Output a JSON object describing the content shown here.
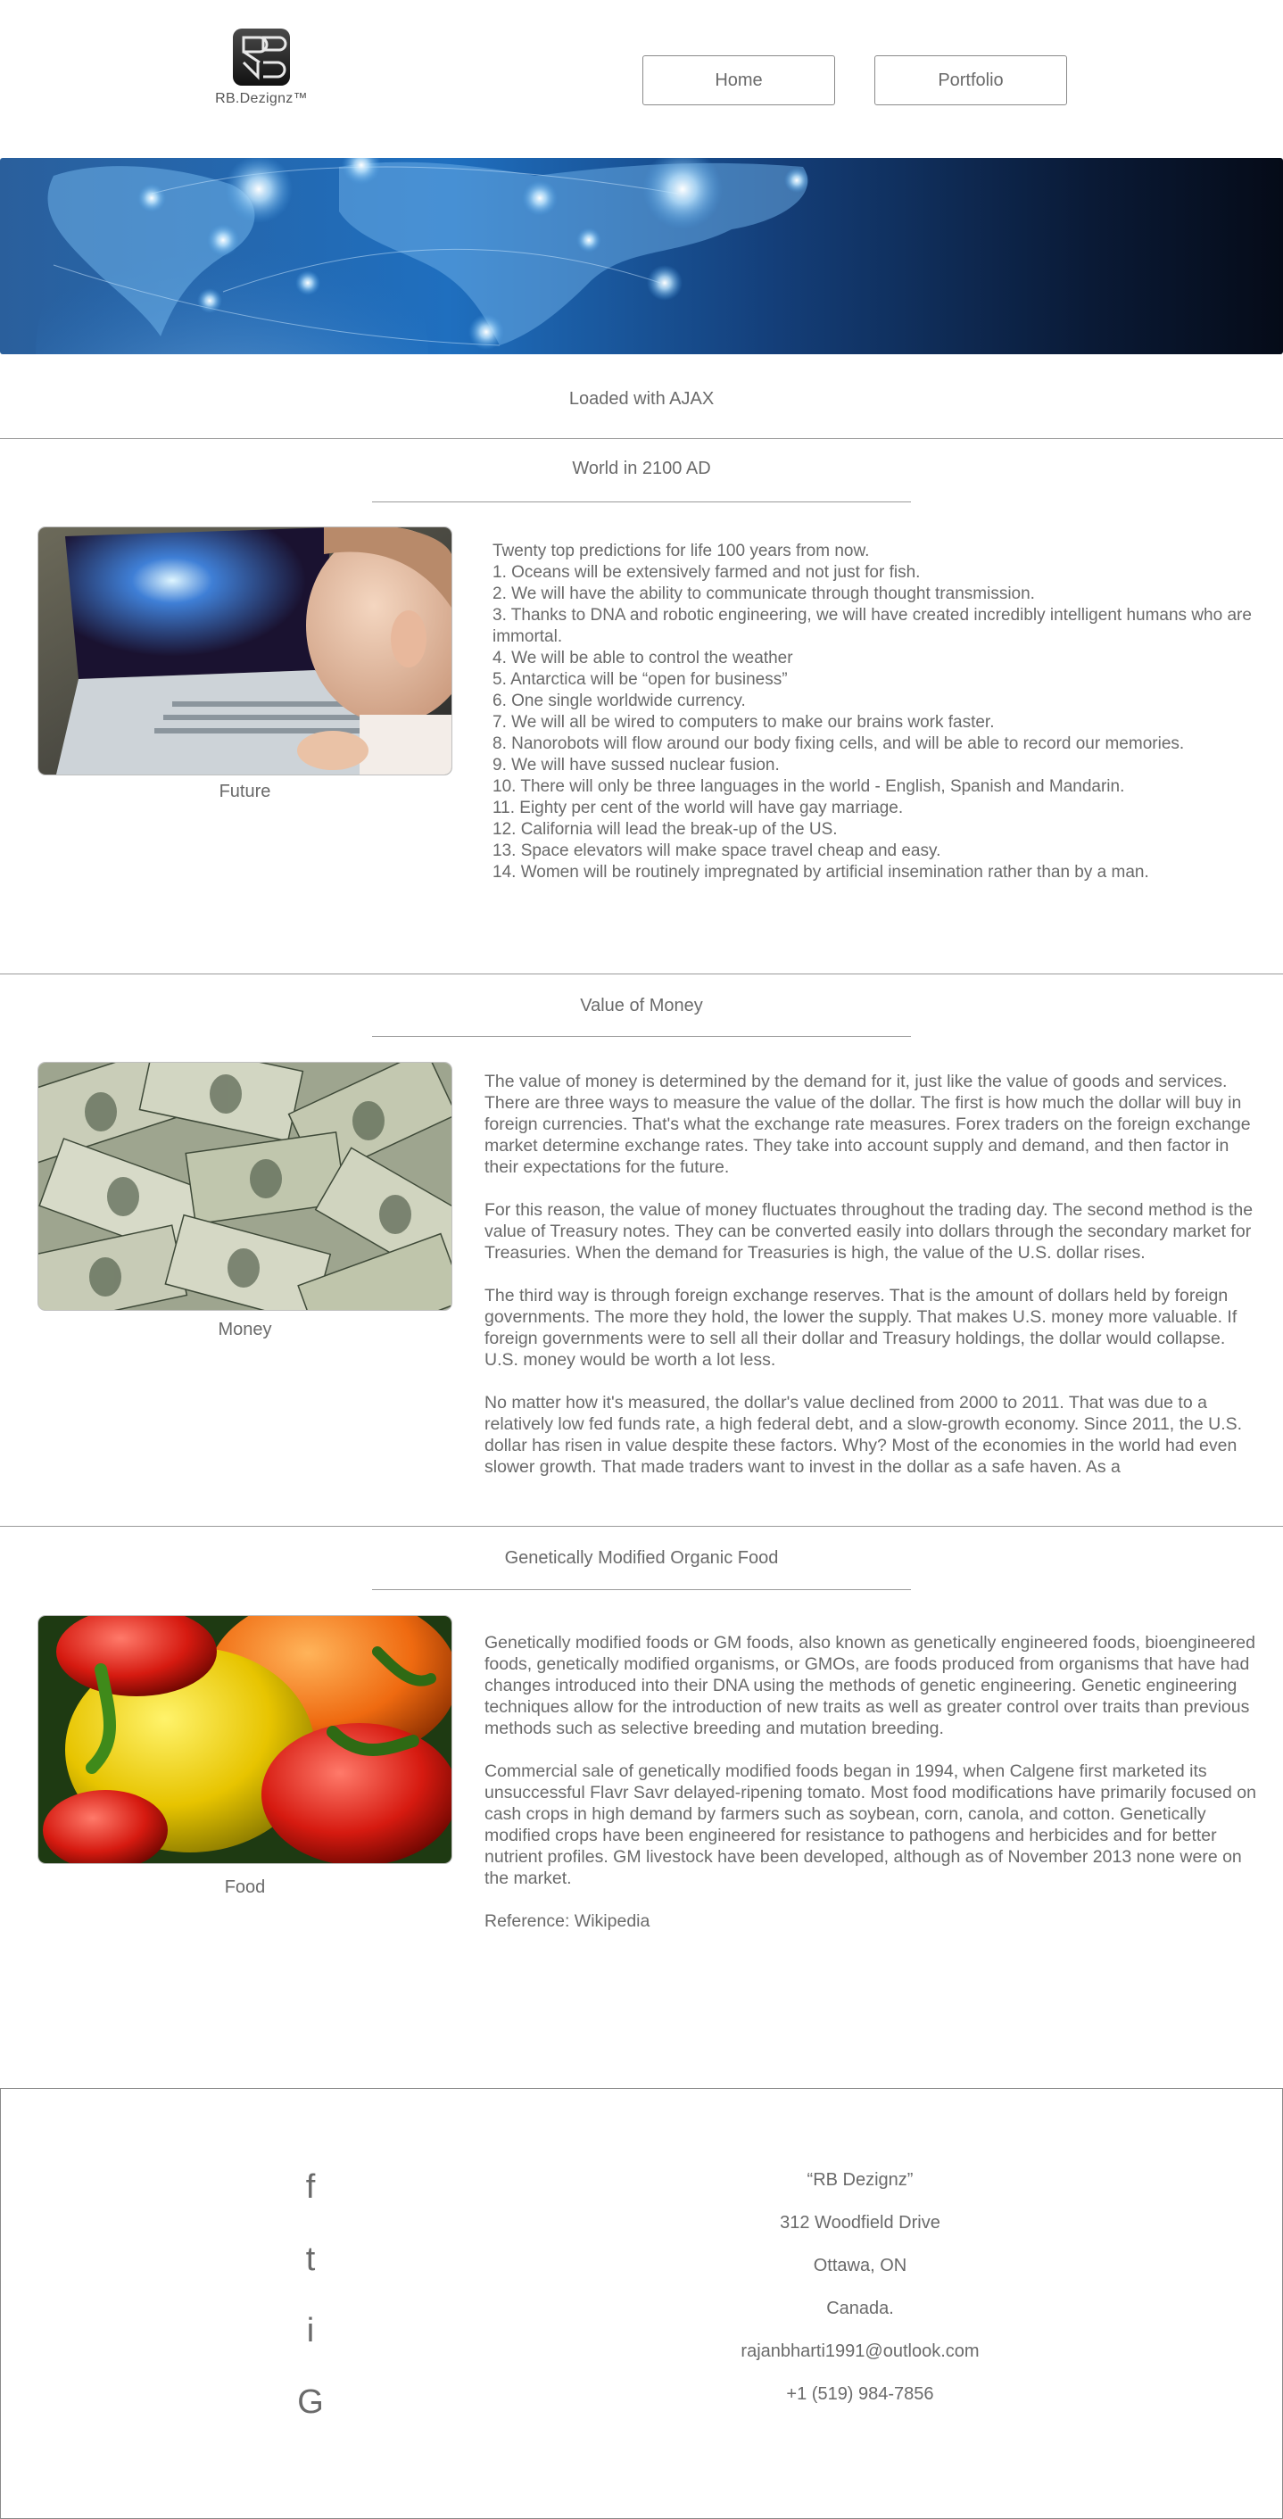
{
  "header": {
    "logo_text": "RB.Dezignz™",
    "nav": [
      {
        "label": "Home"
      },
      {
        "label": "Portfolio"
      }
    ]
  },
  "ajax_label": "Loaded with AJAX",
  "sections": [
    {
      "title": "World in 2100 AD",
      "caption": "Future",
      "intro": "Twenty top predictions for life 100 years from now.",
      "items": [
        "1. Oceans will be extensively farmed and not just for fish.",
        "2. We will have the ability to communicate through thought transmission.",
        "3. Thanks to DNA and robotic engineering, we will have created incredibly intelligent humans who are immortal.",
        "4. We will be able to control the weather",
        "5. Antarctica will be “open for business”",
        "6. One single worldwide currency.",
        "7. We will all be wired to computers to make our brains work faster.",
        "8. Nanorobots will flow around our body fixing cells, and will be able to record our memories.",
        "9. We will have sussed nuclear fusion.",
        "10. There will only be three languages in the world - English, Spanish and Mandarin.",
        "11. Eighty per cent of the world will have gay marriage.",
        "12. California will lead the break-up of the US.",
        "13. Space elevators will make space travel cheap and easy.",
        "14. Women will be routinely impregnated by artificial insemination rather than by a man."
      ]
    },
    {
      "title": "Value of Money",
      "caption": "Money",
      "paragraphs": [
        "The value of money is determined by the demand for it, just like the value of goods and services. There are three ways to measure the value of the dollar. The first is how much the dollar will buy in foreign currencies. That's what the exchange rate measures. Forex traders on the foreign exchange market determine exchange rates. They take into account supply and demand, and then factor in their expectations for the future.",
        "For this reason, the value of money fluctuates throughout the trading day. The second method is the value of Treasury notes. They can be converted easily into dollars through the secondary market for Treasuries. When the demand for Treasuries is high, the value of the U.S. dollar rises.",
        "The third way is through foreign exchange reserves. That is the amount of dollars held by foreign governments. The more they hold, the lower the supply. That makes U.S. money more valuable. If foreign governments were to sell all their dollar and Treasury holdings, the dollar would collapse. U.S. money would be worth a lot less.",
        "No matter how it's measured, the dollar's value declined from 2000 to 2011. That was due to a relatively low fed funds rate, a high federal debt, and a slow-growth economy. Since 2011, the U.S. dollar has risen in value despite these factors. Why? Most of the economies in the world had even slower growth. That made traders want to invest in the dollar as a safe haven. As a"
      ]
    },
    {
      "title": "Genetically Modified Organic Food",
      "caption": "Food",
      "paragraphs": [
        "Genetically modified foods or GM foods, also known as genetically engineered foods, bioengineered foods, genetically modified organisms, or GMOs, are foods produced from organisms that have had changes introduced into their DNA using the methods of genetic engineering. Genetic engineering techniques allow for the introduction of new traits as well as greater control over traits than previous methods such as selective breeding and mutation breeding.",
        "Commercial sale of genetically modified foods began in 1994, when Calgene first marketed its unsuccessful Flavr Savr delayed-ripening tomato. Most food modifications have primarily focused on cash crops in high demand by farmers such as soybean, corn, canola, and cotton. Genetically modified crops have been engineered for resistance to pathogens and herbicides and for better nutrient profiles. GM livestock have been developed, although as of November 2013 none were on the market.",
        "Reference: Wikipedia"
      ]
    }
  ],
  "footer": {
    "social": [
      {
        "glyph": "f",
        "icon": "facebook-icon"
      },
      {
        "glyph": "t",
        "icon": "twitter-icon"
      },
      {
        "glyph": "i",
        "icon": "instagram-icon"
      },
      {
        "glyph": "G",
        "icon": "google-plus-icon"
      }
    ],
    "contact": [
      "“RB Dezignz”",
      "312 Woodfield Drive",
      "Ottawa, ON",
      "Canada.",
      "rajanbharti1991@outlook.com",
      "+1 (519) 984-7856"
    ]
  }
}
